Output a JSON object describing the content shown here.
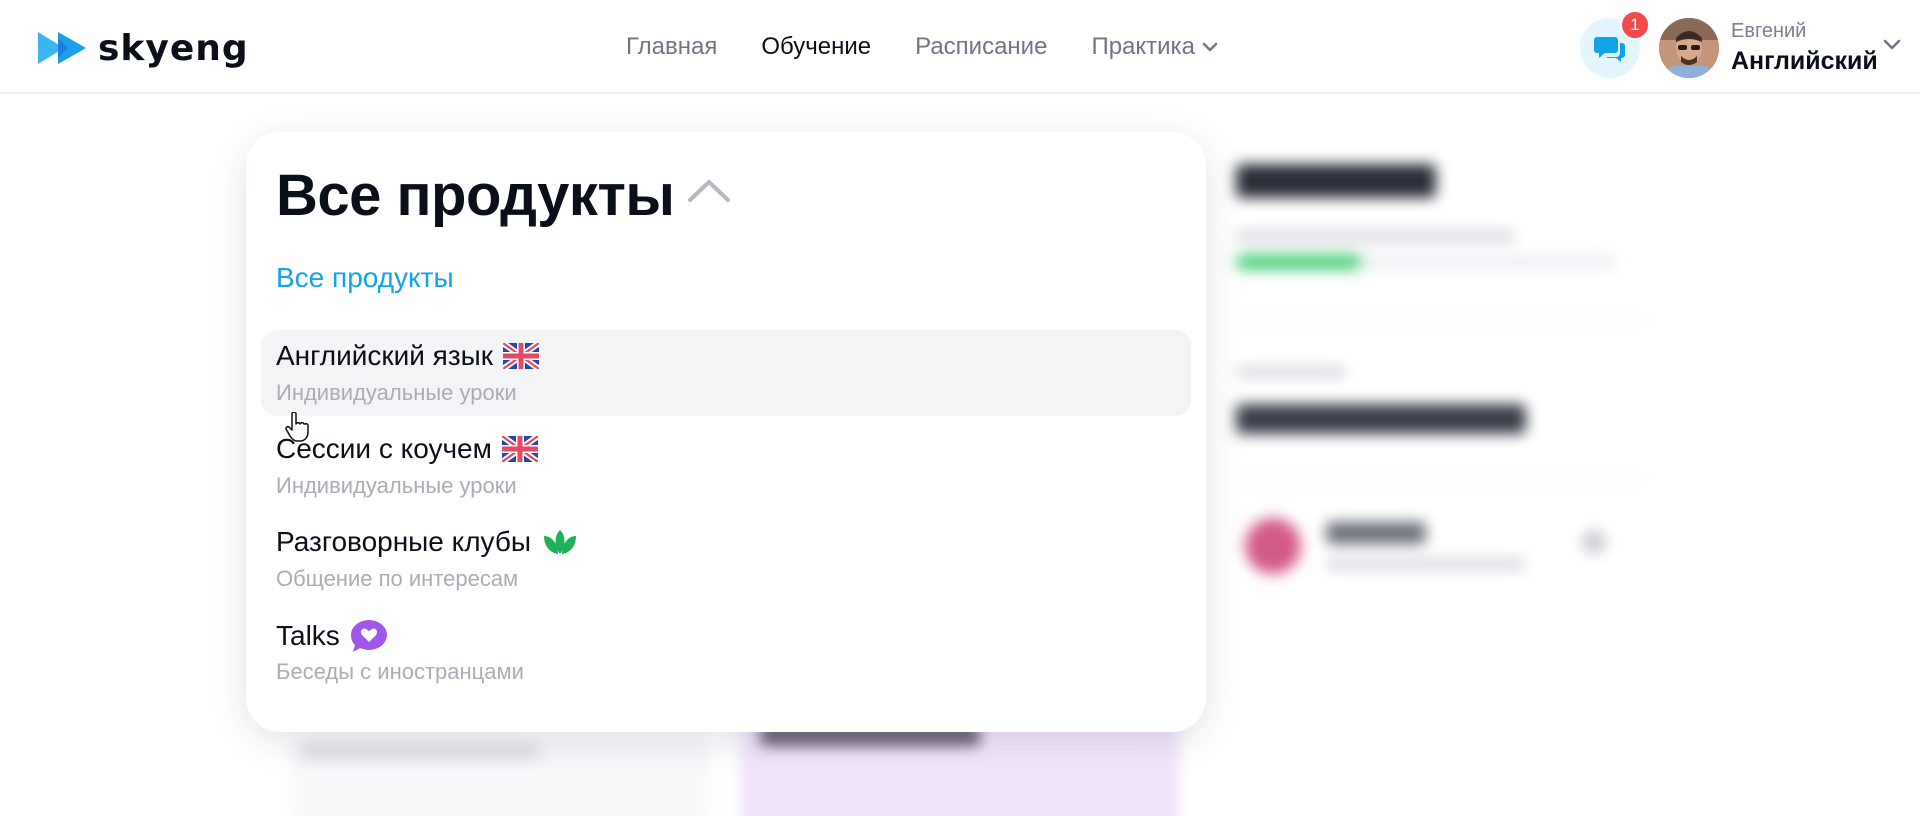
{
  "brand": {
    "name": "skyeng",
    "accent": "#13a3e8"
  },
  "nav": {
    "items": [
      {
        "label": "Главная",
        "active": false
      },
      {
        "label": "Обучение",
        "active": true
      },
      {
        "label": "Расписание",
        "active": false
      },
      {
        "label": "Практика",
        "active": false
      }
    ]
  },
  "header": {
    "chat_icon": "chat-bubbles-icon",
    "notification_count": "1",
    "user": {
      "name": "Евгений",
      "course": "Английский"
    }
  },
  "dropdown": {
    "title": "Все продукты",
    "all_link": "Все продукты",
    "items": [
      {
        "title": "Английский язык",
        "subtitle": "Индивидуальные уроки",
        "icon": "uk-flag-icon"
      },
      {
        "title": "Сессии с коучем",
        "subtitle": "Индивидуальные уроки",
        "icon": "uk-flag-icon"
      },
      {
        "title": "Разговорные клубы",
        "subtitle": "Общение по интересам",
        "icon": "lotus-icon"
      },
      {
        "title": "Talks",
        "subtitle": "Беседы с иностранцами",
        "icon": "heart-bubble-icon"
      }
    ]
  }
}
